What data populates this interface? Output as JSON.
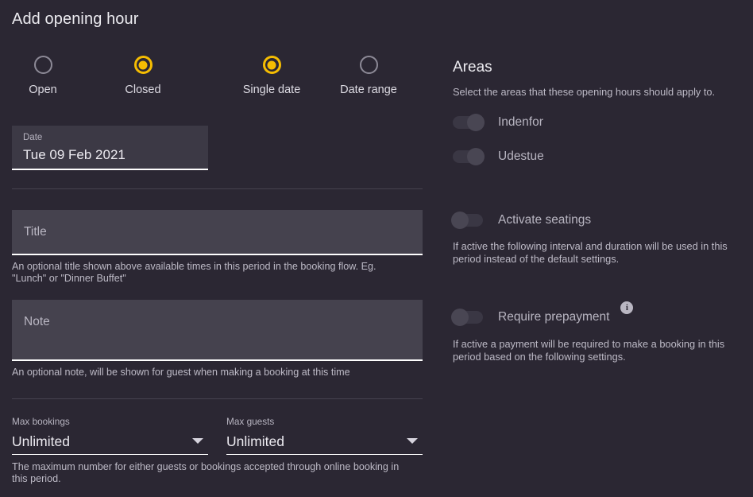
{
  "page": {
    "title": "Add opening hour",
    "accent_color": "#f5bd02",
    "background_color": "#2b2733",
    "field_fill_color": "#45424e"
  },
  "mode_options": [
    {
      "label": "Open",
      "selected": false,
      "name": "open"
    },
    {
      "label": "Closed",
      "selected": true,
      "name": "closed"
    },
    {
      "label": "Single date",
      "selected": true,
      "name": "single-date"
    },
    {
      "label": "Date range",
      "selected": false,
      "name": "date-range"
    }
  ],
  "date_field": {
    "caption": "Date",
    "value": "Tue 09 Feb 2021"
  },
  "title_field": {
    "placeholder": "Title",
    "value": "",
    "helper": "An optional title shown above available times in this period in the booking flow. Eg. \"Lunch\" or \"Dinner Buffet\""
  },
  "note_field": {
    "placeholder": "Note",
    "value": "",
    "helper": "An optional note, will be shown for guest when making a booking at this time"
  },
  "max_bookings": {
    "caption": "Max bookings",
    "value": "Unlimited"
  },
  "max_guests": {
    "caption": "Max guests",
    "value": "Unlimited"
  },
  "max_helper": "The maximum number for either guests or bookings accepted through online booking in this period.",
  "areas": {
    "title": "Areas",
    "subtitle": "Select the areas that these opening hours should apply to.",
    "items": [
      {
        "label": "Indenfor",
        "on": false,
        "knob": "right"
      },
      {
        "label": "Udestue",
        "on": false,
        "knob": "right"
      }
    ]
  },
  "seatings": {
    "label": "Activate seatings",
    "on": false,
    "knob": "left",
    "description": "If active the following interval and duration will be used in this period instead of the default settings."
  },
  "prepayment": {
    "label": "Require prepayment",
    "on": false,
    "knob": "left",
    "info_icon": "info-icon",
    "info_glyph": "i",
    "description": "If active a payment will be required to make a booking in this period based on the following settings."
  },
  "icons": {
    "dropdown": "chevron-down-icon"
  }
}
